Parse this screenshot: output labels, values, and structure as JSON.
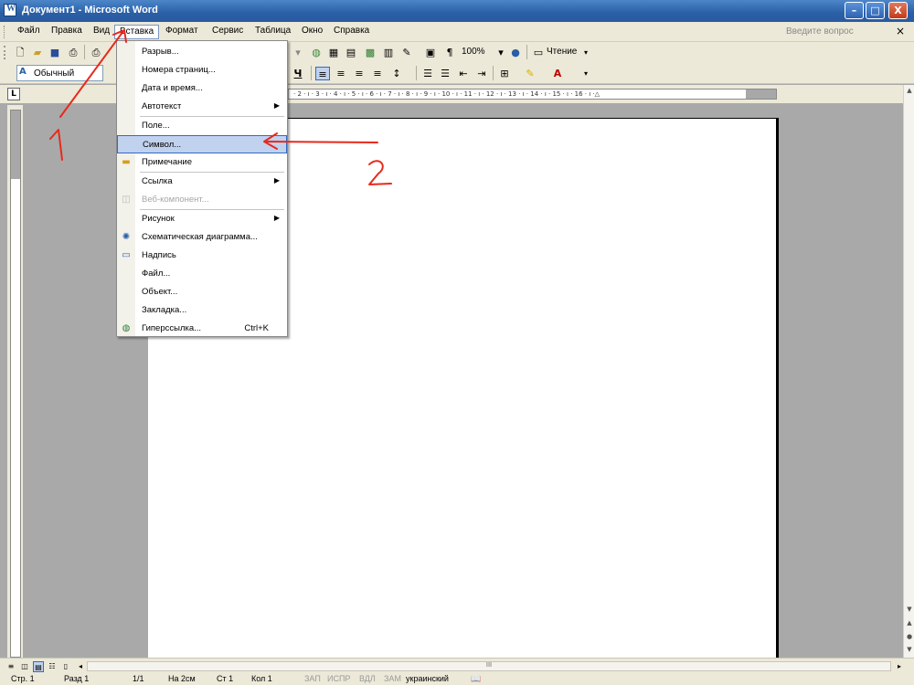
{
  "window": {
    "title": "Документ1 - Microsoft Word",
    "min": "–",
    "max": "□",
    "close": "X"
  },
  "menubar": {
    "items": [
      "Файл",
      "Правка",
      "Вид",
      "Вставка",
      "Формат",
      "Сервис",
      "Таблица",
      "Окно",
      "Справка"
    ],
    "ask_placeholder": "Введите вопрос",
    "close_doc": "×"
  },
  "toolbar": {
    "zoom": "100%",
    "reading": "Чтение",
    "style": "Обычный",
    "pilcrow": "¶",
    "underline": "Ч"
  },
  "insert_menu": {
    "items": [
      {
        "label": "Разрыв...",
        "shortcut": "",
        "submenu": false,
        "enabled": true,
        "icon": ""
      },
      {
        "label": "Номера страниц...",
        "shortcut": "",
        "submenu": false,
        "enabled": true,
        "icon": ""
      },
      {
        "label": "Дата и время...",
        "shortcut": "",
        "submenu": false,
        "enabled": true,
        "icon": ""
      },
      {
        "label": "Автотекст",
        "shortcut": "",
        "submenu": true,
        "enabled": true,
        "icon": ""
      },
      {
        "label": "Поле...",
        "shortcut": "",
        "submenu": false,
        "enabled": true,
        "icon": ""
      },
      {
        "label": "Символ...",
        "shortcut": "",
        "submenu": false,
        "enabled": true,
        "icon": "",
        "highlighted": true
      },
      {
        "label": "Примечание",
        "shortcut": "",
        "submenu": false,
        "enabled": true,
        "icon": "note-icon"
      },
      {
        "label": "Ссылка",
        "shortcut": "",
        "submenu": true,
        "enabled": true,
        "icon": ""
      },
      {
        "label": "Веб-компонент...",
        "shortcut": "",
        "submenu": false,
        "enabled": false,
        "icon": "web-component-icon"
      },
      {
        "label": "Рисунок",
        "shortcut": "",
        "submenu": true,
        "enabled": true,
        "icon": ""
      },
      {
        "label": "Схематическая диаграмма...",
        "shortcut": "",
        "submenu": false,
        "enabled": true,
        "icon": "diagram-icon"
      },
      {
        "label": "Надпись",
        "shortcut": "",
        "submenu": false,
        "enabled": true,
        "icon": "textbox-icon"
      },
      {
        "label": "Файл...",
        "shortcut": "",
        "submenu": false,
        "enabled": true,
        "icon": ""
      },
      {
        "label": "Объект...",
        "shortcut": "",
        "submenu": false,
        "enabled": true,
        "icon": ""
      },
      {
        "label": "Закладка...",
        "shortcut": "",
        "submenu": false,
        "enabled": true,
        "icon": ""
      },
      {
        "label": "Гиперссылка...",
        "shortcut": "Ctrl+K",
        "submenu": false,
        "enabled": true,
        "icon": "hyperlink-icon"
      }
    ]
  },
  "annotations": {
    "step1": "1",
    "step2": "2",
    "color": "#e8291c"
  },
  "statusbar": {
    "page": "Стр. 1",
    "section": "Разд 1",
    "pages": "1/1",
    "at": "На 2см",
    "line": "Ст 1",
    "col": "Кол 1",
    "rec": "ЗАП",
    "trk": "ИСПР",
    "ext": "ВДЛ",
    "ovr": "ЗАМ",
    "lang": "украинский"
  }
}
